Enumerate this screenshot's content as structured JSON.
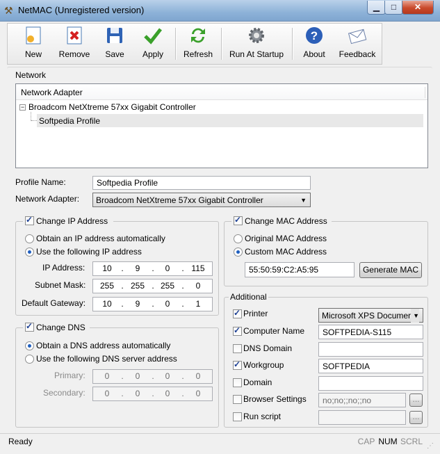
{
  "window": {
    "title": "NetMAC (Unregistered version)"
  },
  "toolbar": {
    "new": "New",
    "remove": "Remove",
    "save": "Save",
    "apply": "Apply",
    "refresh": "Refresh",
    "run_at_startup": "Run At Startup",
    "about": "About",
    "feedback": "Feedback"
  },
  "network": {
    "section_label": "Network",
    "tree_header": "Network Adapter",
    "adapter_node": "Broadcom NetXtreme 57xx Gigabit Controller",
    "profile_node": "Softpedia Profile"
  },
  "profile": {
    "name_label": "Profile Name:",
    "name_value": "Softpedia Profile",
    "adapter_label": "Network Adapter:",
    "adapter_value": "Broadcom NetXtreme 57xx Gigabit Controller"
  },
  "ip": {
    "group_label": "Change IP Address",
    "auto_label": "Obtain an IP address automatically",
    "manual_label": "Use the following IP address",
    "address_label": "IP Address:",
    "address": [
      "10",
      "9",
      "0",
      "115"
    ],
    "mask_label": "Subnet Mask:",
    "mask": [
      "255",
      "255",
      "255",
      "0"
    ],
    "gateway_label": "Default Gateway:",
    "gateway": [
      "10",
      "9",
      "0",
      "1"
    ]
  },
  "mac": {
    "group_label": "Change MAC Address",
    "original_label": "Original MAC Address",
    "custom_label": "Custom MAC Address",
    "value": "55:50:59:C2:A5:95",
    "generate_label": "Generate MAC"
  },
  "dns": {
    "group_label": "Change DNS",
    "auto_label": "Obtain a DNS address automatically",
    "manual_label": "Use the following DNS server address",
    "primary_label": "Primary:",
    "primary": [
      "0",
      "0",
      "0",
      "0"
    ],
    "secondary_label": "Secondary:",
    "secondary": [
      "0",
      "0",
      "0",
      "0"
    ]
  },
  "additional": {
    "group_label": "Additional",
    "printer_label": "Printer",
    "printer_value": "Microsoft XPS Documer",
    "computer_label": "Computer Name",
    "computer_value": "SOFTPEDIA-S115",
    "dns_domain_label": "DNS Domain",
    "workgroup_label": "Workgroup",
    "workgroup_value": "SOFTPEDIA",
    "domain_label": "Domain",
    "browser_label": "Browser Settings",
    "browser_value": "no;no;;no;;no",
    "script_label": "Run script",
    "ellipsis": "..."
  },
  "status": {
    "text": "Ready",
    "cap": "CAP",
    "num": "NUM",
    "scrl": "SCRL"
  }
}
